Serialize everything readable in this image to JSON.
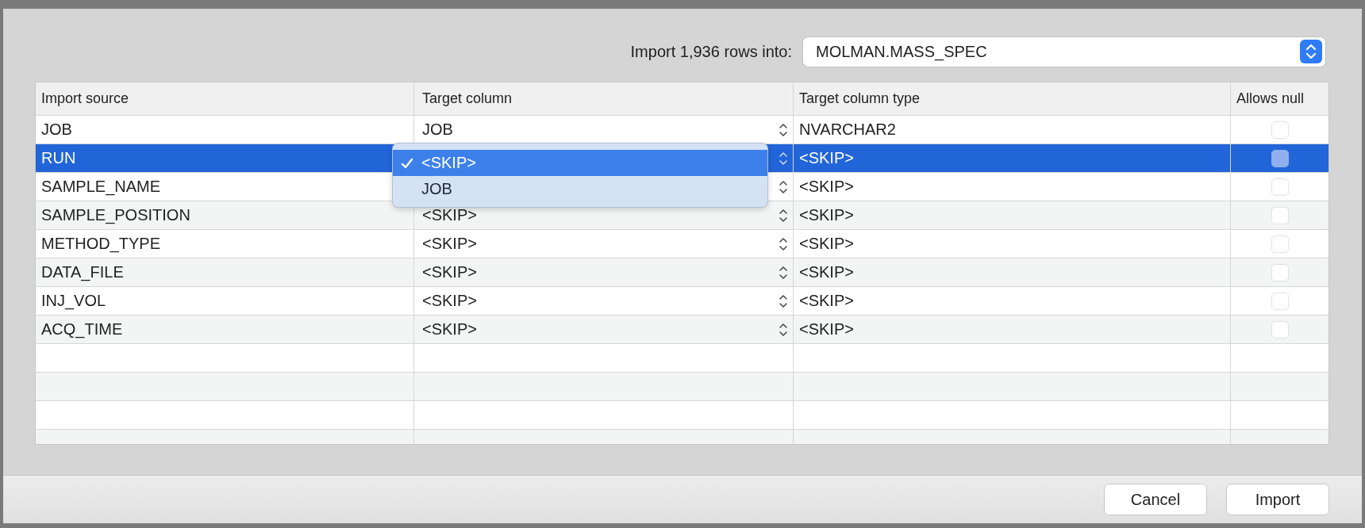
{
  "import_target": {
    "label": "Import 1,936 rows into:",
    "value": "MOLMAN.MASS_SPEC"
  },
  "table": {
    "columns": [
      "Import source",
      "Target column",
      "Target column type",
      "Allows null"
    ],
    "rows": [
      {
        "source": "JOB",
        "target": "JOB",
        "type": "NVARCHAR2",
        "allows_null": false,
        "selected": false
      },
      {
        "source": "RUN",
        "type": "<SKIP>",
        "allows_null": false,
        "selected": true
      },
      {
        "source": "SAMPLE_NAME",
        "type": "<SKIP>",
        "allows_null": false,
        "selected": false
      },
      {
        "source": "SAMPLE_POSITION",
        "target": "<SKIP>",
        "type": "<SKIP>",
        "allows_null": false,
        "selected": false
      },
      {
        "source": "METHOD_TYPE",
        "target": "<SKIP>",
        "type": "<SKIP>",
        "allows_null": false,
        "selected": false
      },
      {
        "source": "DATA_FILE",
        "target": "<SKIP>",
        "type": "<SKIP>",
        "allows_null": false,
        "selected": false
      },
      {
        "source": "INJ_VOL",
        "target": "<SKIP>",
        "type": "<SKIP>",
        "allows_null": false,
        "selected": false
      },
      {
        "source": "ACQ_TIME",
        "target": "<SKIP>",
        "type": "<SKIP>",
        "allows_null": false,
        "selected": false
      }
    ]
  },
  "popup_menu": {
    "items": [
      {
        "label": "<SKIP>",
        "selected": true
      },
      {
        "label": "JOB",
        "selected": false
      }
    ]
  },
  "buttons": [
    "Cancel",
    "Import"
  ]
}
